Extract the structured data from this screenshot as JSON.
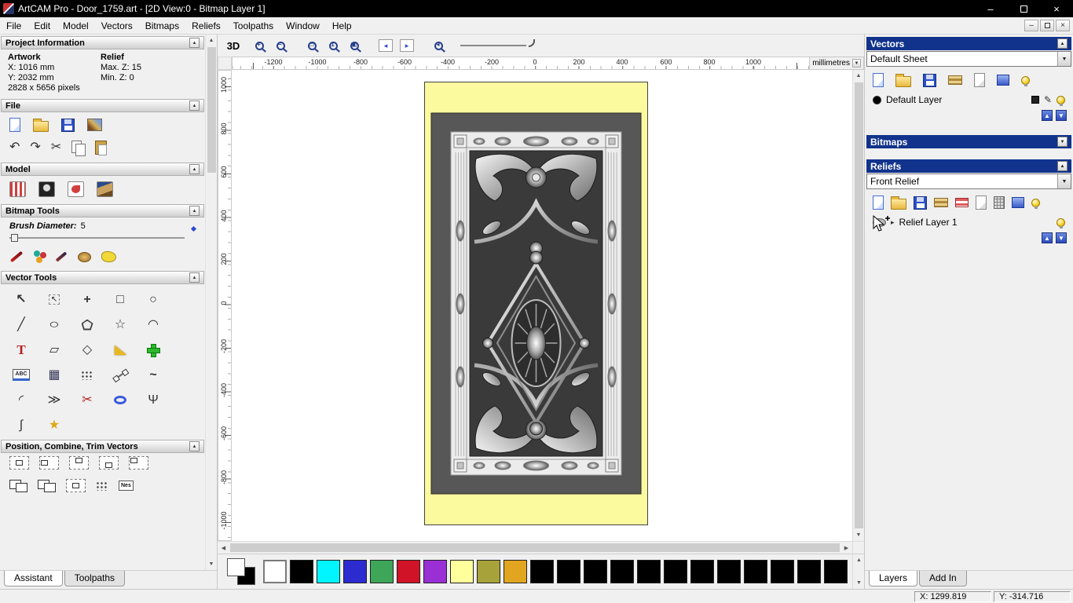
{
  "window": {
    "title": "ArtCAM Pro - Door_1759.art - [2D View:0 - Bitmap Layer 1]"
  },
  "menubar": {
    "items": [
      "File",
      "Edit",
      "Model",
      "Vectors",
      "Bitmaps",
      "Reliefs",
      "Toolpaths",
      "Window",
      "Help"
    ]
  },
  "left_panel": {
    "project_information": {
      "header": "Project Information",
      "artwork_label": "Artwork",
      "relief_label": "Relief",
      "artwork_x": "X: 1016 mm",
      "artwork_y": "Y: 2032 mm",
      "relief_max_z": "Max. Z: 15",
      "relief_min_z": "Min. Z: 0",
      "pixels": "2828 x 5656 pixels"
    },
    "file": {
      "header": "File"
    },
    "model": {
      "header": "Model"
    },
    "bitmap_tools": {
      "header": "Bitmap Tools",
      "brush_diameter_label": "Brush Diameter:",
      "brush_diameter_value": "5"
    },
    "vector_tools": {
      "header": "Vector Tools",
      "abc_label": "ABC",
      "nest_label": "Nes"
    },
    "position_tools": {
      "header": "Position, Combine, Trim Vectors"
    },
    "tabs": [
      {
        "label": "Assistant"
      },
      {
        "label": "Toolpaths"
      }
    ]
  },
  "canvas": {
    "toolbar": {
      "view_3d_label": "3D"
    },
    "ruler": {
      "units_label": "millimetres",
      "h_ticks": [
        "-1200",
        "-1000",
        "-800",
        "-600",
        "-400",
        "-200",
        "0",
        "200",
        "400",
        "600",
        "800",
        "1000"
      ],
      "v_ticks": [
        "1000",
        "800",
        "600",
        "400",
        "200",
        "0",
        "-200",
        "-400",
        "-600",
        "-800",
        "-1000"
      ]
    },
    "door": {
      "panel_color": "#fbfa9e",
      "mat_color": "#575757"
    }
  },
  "palette": {
    "primary": "#ffffff",
    "secondary": "#000000",
    "swatches": [
      "#ffffff",
      "#000000",
      "#00f5ff",
      "#2b2bd0",
      "#3ea659",
      "#d01326",
      "#9a2fd6",
      "#ffff9c",
      "#a8a23b",
      "#e2a51f",
      "#000000",
      "#000000",
      "#000000",
      "#000000",
      "#000000",
      "#000000",
      "#000000",
      "#000000",
      "#000000",
      "#000000",
      "#000000",
      "#000000"
    ]
  },
  "right_panel": {
    "vectors": {
      "header": "Vectors",
      "sheet_value": "Default Sheet",
      "layer_name": "Default Layer",
      "layer_color": "#000000"
    },
    "bitmaps": {
      "header": "Bitmaps"
    },
    "reliefs": {
      "header": "Reliefs",
      "relief_value": "Front Relief",
      "layer_name": "Relief Layer 1"
    },
    "tabs": [
      {
        "label": "Layers"
      },
      {
        "label": "Add In"
      }
    ]
  },
  "statusbar": {
    "x_readout": "X: 1299.819",
    "y_readout": "Y: -314.716"
  },
  "colors": {
    "panel_header": "#11338c",
    "titlebar": "#000000"
  },
  "icons": {
    "minimize": "–",
    "close": "×",
    "collapse": "▲",
    "expand": "▼",
    "dropdown": "▼",
    "scroll_up": "▲",
    "scroll_down": "▼",
    "scroll_left": "◀",
    "scroll_right": "▶",
    "undo": "↶",
    "redo": "↷",
    "cut": "✂",
    "select": "↖",
    "move": "+",
    "rectangle": "□",
    "circle": "○",
    "polyline": "╱",
    "star": "☆",
    "star_filled": "★",
    "arc": "◠",
    "quarter_arc": "◜",
    "text": "T",
    "envelope": "▱",
    "diamond": "◇",
    "grid": "▦",
    "wave": "~",
    "offset": "≫",
    "measure": "Ψ",
    "profile": "∫",
    "pencil": "✎",
    "expander": "▸",
    "zoom_in": "+",
    "zoom_out": "−",
    "zoom_box": "▭",
    "zoom_11": "1",
    "zoom_fit": "▣",
    "zoom_prev": "◂",
    "page_left": "◂",
    "page_right": "▸",
    "up": "▲",
    "down": "▼"
  }
}
